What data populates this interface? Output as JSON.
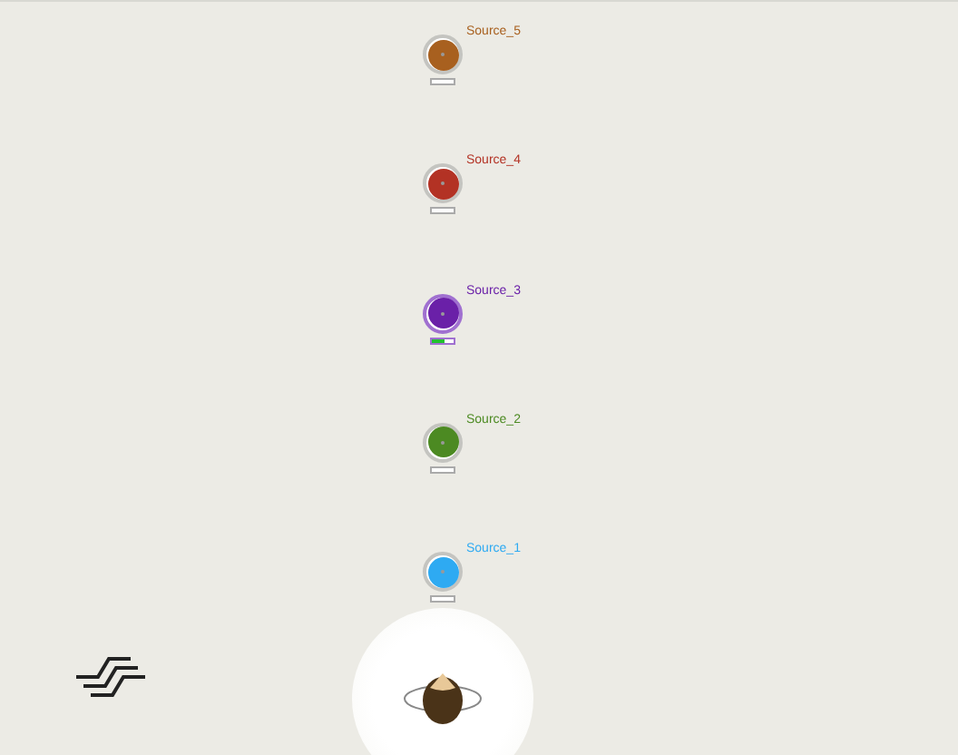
{
  "sources": [
    {
      "name": "Source_5",
      "color": "#a8601f",
      "selected": false,
      "level": 0
    },
    {
      "name": "Source_4",
      "color": "#b33224",
      "selected": false,
      "level": 0
    },
    {
      "name": "Source_3",
      "color": "#6a20a8",
      "selected": true,
      "level": 0.6
    },
    {
      "name": "Source_2",
      "color": "#4c8a22",
      "selected": false,
      "level": 0
    },
    {
      "name": "Source_1",
      "color": "#2eaaf2",
      "selected": false,
      "level": 0
    }
  ]
}
